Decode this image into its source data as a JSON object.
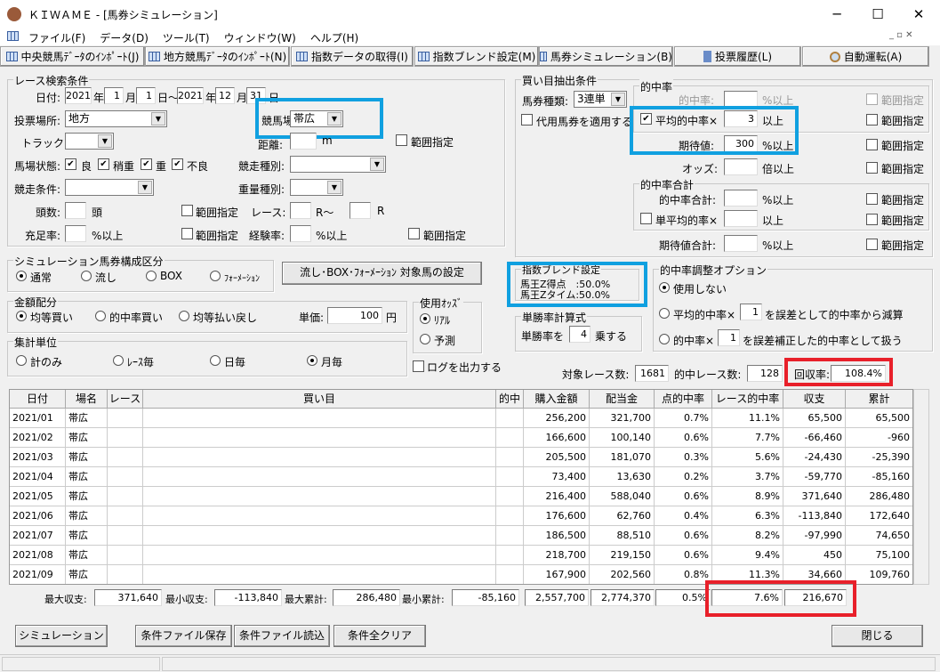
{
  "window": {
    "title": "ＫＩＷＡＭＥ - [馬券シミュレーション]",
    "minimize": "─",
    "maximize": "☐",
    "close": "✕"
  },
  "menu": [
    "ファイル(F)",
    "データ(D)",
    "ツール(T)",
    "ウィンドウ(W)",
    "ヘルプ(H)"
  ],
  "toolbar": [
    "中央競馬ﾃﾞｰﾀのｲﾝﾎﾟｰﾄ(J)",
    "地方競馬ﾃﾞｰﾀのｲﾝﾎﾟｰﾄ(N)",
    "指数データの取得(I)",
    "指数ブレンド設定(M)",
    "馬券シミュレーション(B)",
    "投票履歴(L)",
    "自動運転(A)"
  ],
  "race": {
    "legend": "レース検索条件",
    "date_label": "日付:",
    "y1": "2021",
    "m1": "1",
    "d1": "1",
    "y2": "2021",
    "m2": "12",
    "d2": "31",
    "nen": "年",
    "tsuki": "月",
    "hi": "日",
    "hi_kara": "日～",
    "venue_label": "投票場所:",
    "venue": "地方",
    "course_label": "競馬場:",
    "course": "帯広",
    "track_label": "トラック:",
    "distance_label": "距離:",
    "m": "m",
    "range": "範囲指定",
    "cond_label": "馬場状態:",
    "conds": [
      "良",
      "稍重",
      "重",
      "不良"
    ],
    "kind_label": "競走種別:",
    "race_cond_label": "競走条件:",
    "weight_label": "重量種別:",
    "heads_label": "頭数:",
    "heads_unit": "頭",
    "race_label": "レース:",
    "r_from": "R～",
    "r_to": "R",
    "fill_label": "充足率:",
    "pct_over": "%以上",
    "exp_label": "経験率:"
  },
  "buy": {
    "legend": "買い目抽出条件",
    "type_label": "馬券種類:",
    "type": "3連単",
    "sub_label": "代用馬券を適用する",
    "hit_legend": "的中率",
    "hit_label": "的中率:",
    "pct_over": "%以上",
    "avg_label": "平均的中率×",
    "avg_value": "3",
    "over": "以上",
    "ev_label": "期待値:",
    "ev_value": "300",
    "odds_label": "オッズ:",
    "odds_unit": "倍以上",
    "sum_legend": "的中率合計",
    "hit_sum_label": "的中率合計:",
    "single_avg_label": "単平均的率×",
    "ev_sum_label": "期待値合計:",
    "range": "範囲指定"
  },
  "sim": {
    "legend": "シミュレーション馬券構成区分",
    "opts": [
      "通常",
      "流し",
      "BOX",
      "ﾌｫｰﾒｰｼｮﾝ"
    ],
    "target_btn": "流し･BOX･ﾌｫｰﾒｰｼｮﾝ 対象馬の設定"
  },
  "money": {
    "legend": "金額配分",
    "opts": [
      "均等買い",
      "的中率買い",
      "均等払い戻し"
    ],
    "unit_label": "単価:",
    "unit": "100",
    "yen": "円"
  },
  "odds": {
    "legend": "使用ｵｯｽﾞ",
    "opts": [
      "ﾘｱﾙ",
      "予測"
    ]
  },
  "agg": {
    "legend": "集計単位",
    "opts": [
      "計のみ",
      "ﾚｰｽ毎",
      "日毎",
      "月毎"
    ]
  },
  "log_label": "ログを出力する",
  "blend": {
    "legend": "指数ブレンド設定",
    "l1": "馬王Z得点　:50.0%",
    "l2": "馬王Zタイム:50.0%"
  },
  "win": {
    "legend": "単勝率計算式",
    "pre": "単勝率を",
    "value": "4",
    "post": "乗する"
  },
  "adj": {
    "legend": "的中率調整オプション",
    "o1": "使用しない",
    "o2a": "平均的中率×",
    "o2v": "1",
    "o2b": "を誤差として的中率から減算",
    "o3a": "的中率×",
    "o3v": "1",
    "o3b": "を誤差補正した的中率として扱う"
  },
  "stats": {
    "target_label": "対象レース数:",
    "target": "1681",
    "hit_label": "的中レース数:",
    "hit": "128",
    "roi_label": "回収率:",
    "roi": "108.4%"
  },
  "table": {
    "headers": [
      "日付",
      "場名",
      "レース",
      "買い目",
      "的中",
      "購入金額",
      "配当金",
      "点的中率",
      "レース的中率",
      "収支",
      "累計"
    ],
    "rows": [
      [
        "2021/01",
        "帯広",
        "",
        "",
        "",
        "256,200",
        "321,700",
        "0.7%",
        "11.1%",
        "65,500",
        "65,500"
      ],
      [
        "2021/02",
        "帯広",
        "",
        "",
        "",
        "166,600",
        "100,140",
        "0.6%",
        "7.7%",
        "-66,460",
        "-960"
      ],
      [
        "2021/03",
        "帯広",
        "",
        "",
        "",
        "205,500",
        "181,070",
        "0.3%",
        "5.6%",
        "-24,430",
        "-25,390"
      ],
      [
        "2021/04",
        "帯広",
        "",
        "",
        "",
        "73,400",
        "13,630",
        "0.2%",
        "3.7%",
        "-59,770",
        "-85,160"
      ],
      [
        "2021/05",
        "帯広",
        "",
        "",
        "",
        "216,400",
        "588,040",
        "0.6%",
        "8.9%",
        "371,640",
        "286,480"
      ],
      [
        "2021/06",
        "帯広",
        "",
        "",
        "",
        "176,600",
        "62,760",
        "0.4%",
        "6.3%",
        "-113,840",
        "172,640"
      ],
      [
        "2021/07",
        "帯広",
        "",
        "",
        "",
        "186,500",
        "88,510",
        "0.6%",
        "8.2%",
        "-97,990",
        "74,650"
      ],
      [
        "2021/08",
        "帯広",
        "",
        "",
        "",
        "218,700",
        "219,150",
        "0.6%",
        "9.4%",
        "450",
        "75,100"
      ],
      [
        "2021/09",
        "帯広",
        "",
        "",
        "",
        "167,900",
        "202,560",
        "0.8%",
        "11.3%",
        "34,660",
        "109,760"
      ]
    ]
  },
  "summary": {
    "max_label": "最大収支:",
    "max": "371,640",
    "min_label": "最小収支:",
    "min": "-113,840",
    "maxc_label": "最大累計:",
    "maxc": "286,480",
    "minc_label": "最小累計:",
    "minc": "-85,160",
    "buy": "2,557,700",
    "pay": "2,774,370",
    "pt": "0.5%",
    "race": "7.6%",
    "total": "216,670"
  },
  "buttons": {
    "sim": "シミュレーション",
    "save": "条件ファイル保存",
    "load": "条件ファイル読込",
    "clear": "条件全クリア",
    "close": "閉じる"
  }
}
